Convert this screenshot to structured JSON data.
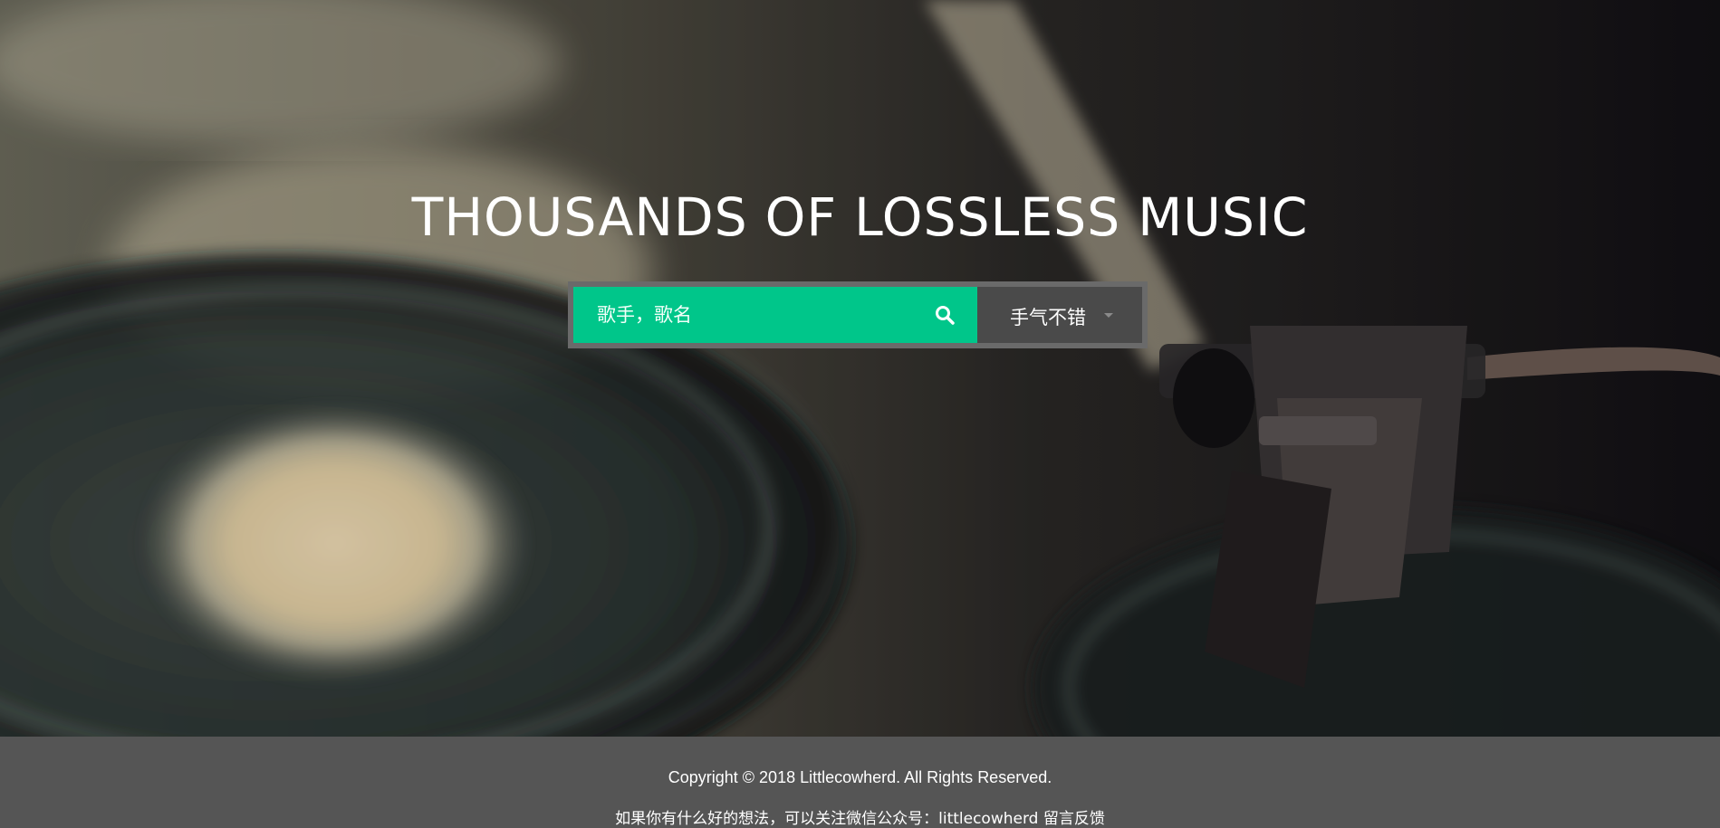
{
  "hero": {
    "title": "THOUSANDS OF LOSSLESS MUSIC",
    "background_icon": "turntable-photo"
  },
  "search": {
    "placeholder": "歌手，歌名",
    "value": "",
    "icon": "search-icon",
    "accent_color": "#00c68a"
  },
  "dropdown": {
    "selected": "手气不错",
    "icon": "caret-down-icon"
  },
  "footer": {
    "copyright": "Copyright © 2018 Littlecowherd. All Rights Reserved.",
    "feedback": "如果你有什么好的想法，可以关注微信公众号：littlecowherd 留言反馈"
  },
  "colors": {
    "footer_bg": "#555555",
    "search_frame": "#6a6a6a",
    "dropdown_bg": "#4a4a4a"
  }
}
